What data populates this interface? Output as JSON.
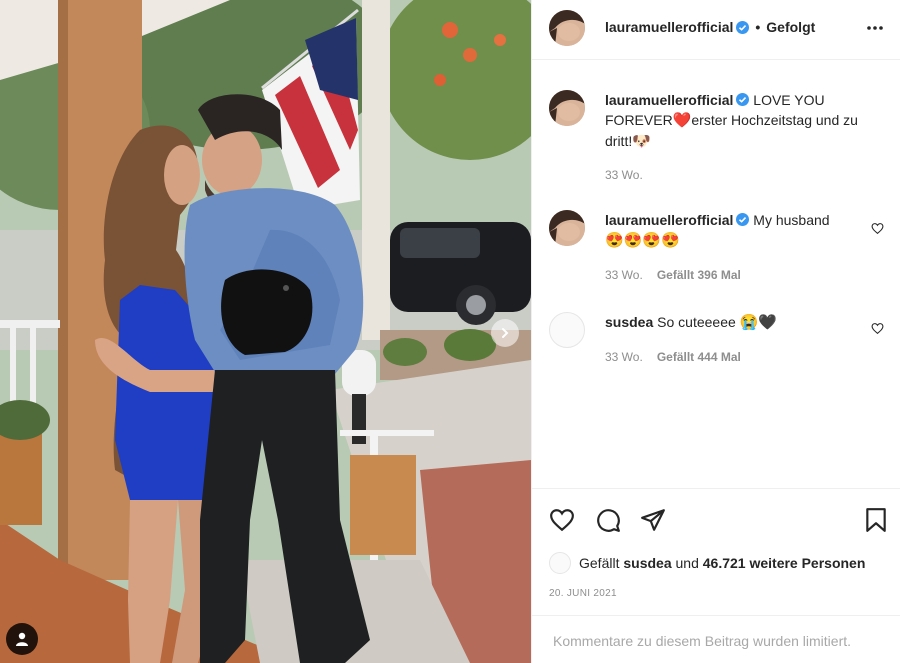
{
  "post": {
    "author": "lauramuellerofficial",
    "follow_state": "Gefolgt",
    "separator": "•",
    "verified": true
  },
  "caption": {
    "username": "lauramuellerofficial",
    "text_1": "LOVE YOU FOREVER",
    "emoji_1": "❤️",
    "text_2": "erster Hochzeitstag und zu dritt!",
    "emoji_2": "🐶",
    "time": "33 Wo."
  },
  "comments": [
    {
      "username": "lauramuellerofficial",
      "text": "My husband",
      "emojis": "😍😍😍😍",
      "time": "33 Wo.",
      "likes": "Gefällt 396 Mal",
      "verified": true
    },
    {
      "username": "susdea",
      "text": "So cuteeeee",
      "emojis": "😭🖤",
      "time": "33 Wo.",
      "likes": "Gefällt 444 Mal",
      "verified": false
    }
  ],
  "likes_summary": {
    "prefix": "Gefällt",
    "user": "susdea",
    "middle": "und",
    "count": "46.721 weitere Personen"
  },
  "date": "20. JUNI 2021",
  "comments_limited": "Kommentare zu diesem Beitrag wurden limitiert.",
  "icons": {
    "like": "heart-icon",
    "comment": "comment-icon",
    "share": "share-icon",
    "save": "bookmark-icon",
    "more": "more-icon",
    "next": "chevron-right-icon",
    "tagged": "user-tag-icon"
  },
  "colors": {
    "verified_blue": "#3897f0",
    "text": "#262626",
    "secondary": "#8e8e8e"
  }
}
